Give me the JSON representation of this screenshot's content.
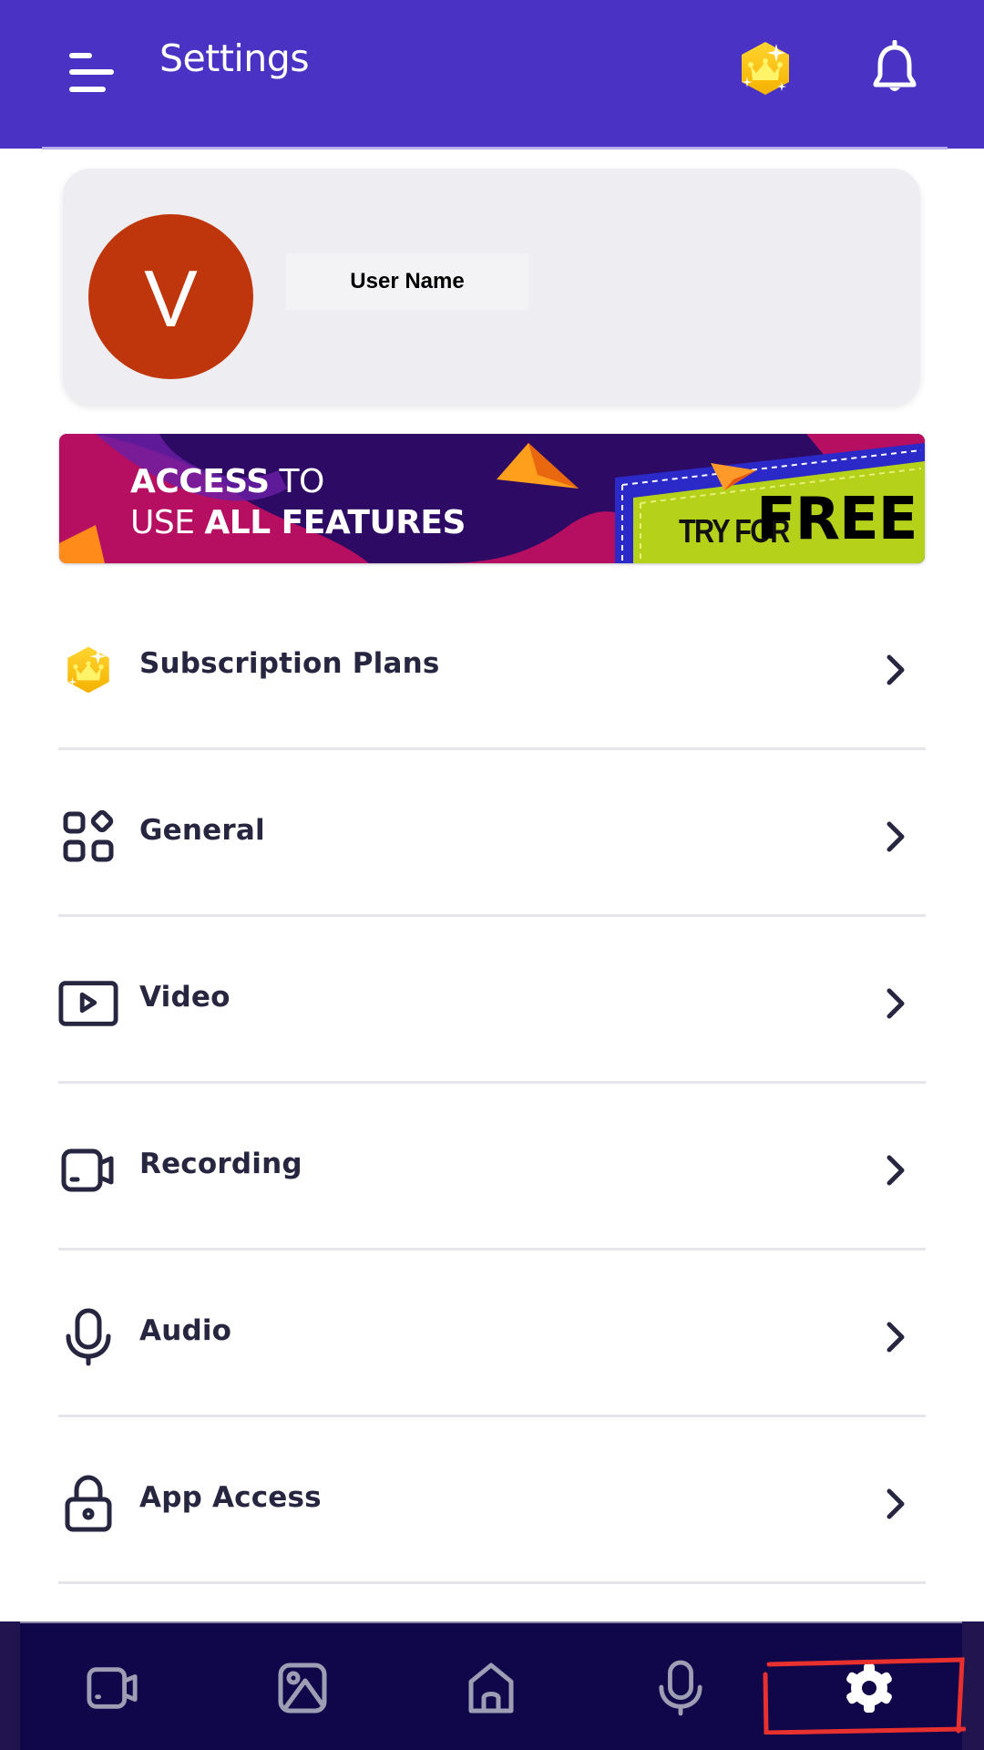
{
  "header": {
    "title": "Settings",
    "menu_icon": "hamburger-menu-icon",
    "premium_icon": "crown-badge-icon",
    "notification_icon": "bell-icon"
  },
  "profile": {
    "avatar_initial": "V",
    "avatar_color": "#bf360c",
    "user_name": "User Name"
  },
  "banner": {
    "line1_bold": "ACCESS",
    "line1_regular": " TO",
    "line2_regular": "USE ",
    "line2_bold": "ALL FEATURES",
    "cta_small": "TRY FOR",
    "cta_big": "FREE"
  },
  "settings": {
    "items": [
      {
        "label": "Subscription Plans",
        "icon": "crown-badge-icon"
      },
      {
        "label": "General",
        "icon": "grid-shapes-icon"
      },
      {
        "label": "Video",
        "icon": "video-play-icon"
      },
      {
        "label": "Recording",
        "icon": "video-camera-icon"
      },
      {
        "label": "Audio",
        "icon": "microphone-icon"
      },
      {
        "label": "App Access",
        "icon": "lock-icon"
      }
    ]
  },
  "bottom_nav": {
    "items": [
      {
        "name": "Record",
        "icon": "video-camera-icon",
        "active": false
      },
      {
        "name": "Gallery",
        "icon": "image-icon",
        "active": false
      },
      {
        "name": "Home",
        "icon": "home-icon",
        "active": false
      },
      {
        "name": "Audio",
        "icon": "microphone-icon",
        "active": false
      },
      {
        "name": "Settings",
        "icon": "gear-icon",
        "active": true
      }
    ]
  },
  "colors": {
    "header": "#4a33c4",
    "nav_background": "#10064a",
    "text_primary": "#272640",
    "annotation": "#e8302e"
  }
}
